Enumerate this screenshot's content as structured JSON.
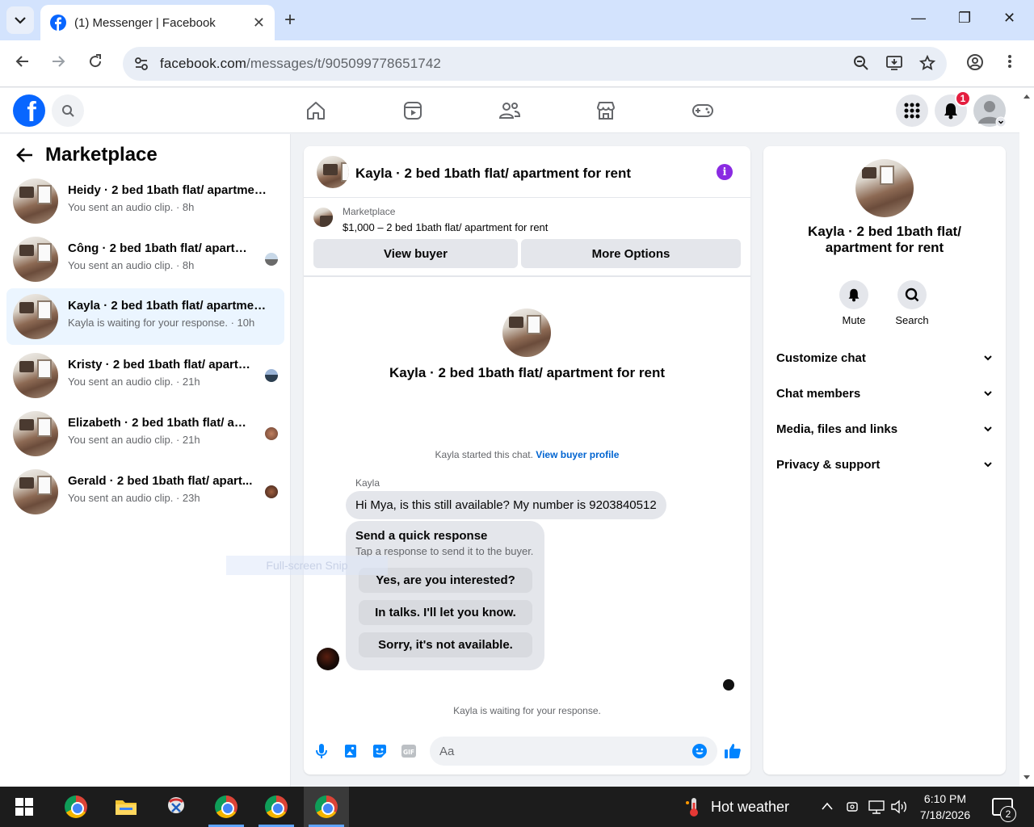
{
  "browser": {
    "tab_title": "(1) Messenger | Facebook",
    "url_host": "facebook.com",
    "url_path": "/messages/t/905099778651742"
  },
  "header": {
    "notification_count": "1"
  },
  "sidebar": {
    "title": "Marketplace",
    "conversations": [
      {
        "name": "Heidy · 2 bed 1bath flat/ apartmen...",
        "sub": "You sent an audio clip. · 8h"
      },
      {
        "name": "Công · 2 bed 1bath flat/ apartm...",
        "sub": "You sent an audio clip. · 8h"
      },
      {
        "name": "Kayla · 2 bed 1bath flat/ apartmen...",
        "sub": "Kayla is waiting for your response. · 10h"
      },
      {
        "name": "Kristy · 2 bed 1bath flat/ apartm...",
        "sub": "You sent an audio clip. · 21h"
      },
      {
        "name": "Elizabeth · 2 bed 1bath flat/ apa...",
        "sub": "You sent an audio clip. · 21h"
      },
      {
        "name": "Gerald · 2 bed 1bath flat/ apart...",
        "sub": "You sent an audio clip. · 23h"
      }
    ],
    "snip_ghost": "Full-screen Snip"
  },
  "chat": {
    "title": "Kayla · 2 bed 1bath flat/ apartment for rent",
    "marketplace_label": "Marketplace",
    "listing": "$1,000 – 2 bed 1bath flat/ apartment for rent",
    "view_buyer": "View buyer",
    "more_options": "More Options",
    "intro_title": "Kayla · 2 bed 1bath flat/ apartment for rent",
    "started_text": "Kayla started this chat.",
    "view_buyer_profile": "View buyer profile",
    "sender": "Kayla",
    "message": "Hi Mya, is this still available? My number is 9203840512",
    "quick_title": "Send a quick response",
    "quick_sub": "Tap a response to send it to the buyer.",
    "quick_replies": [
      "Yes, are you interested?",
      "In talks. I'll let you know.",
      "Sorry, it's not available."
    ],
    "waiting": "Kayla is waiting for your response.",
    "composer_placeholder": "Aa"
  },
  "info_panel": {
    "title": "Kayla · 2 bed 1bath flat/ apartment for rent",
    "mute": "Mute",
    "search": "Search",
    "menu": [
      "Customize chat",
      "Chat members",
      "Media, files and links",
      "Privacy & support"
    ]
  },
  "taskbar": {
    "weather": "Hot weather",
    "time": "6:10 PM",
    "date": "7/18/2026",
    "notifications": "2"
  },
  "colors": {
    "facebook_blue": "#0866ff",
    "messenger_blue": "#0084ff",
    "active_conv": "#ebf5ff",
    "badge_red": "#e41e3f"
  }
}
